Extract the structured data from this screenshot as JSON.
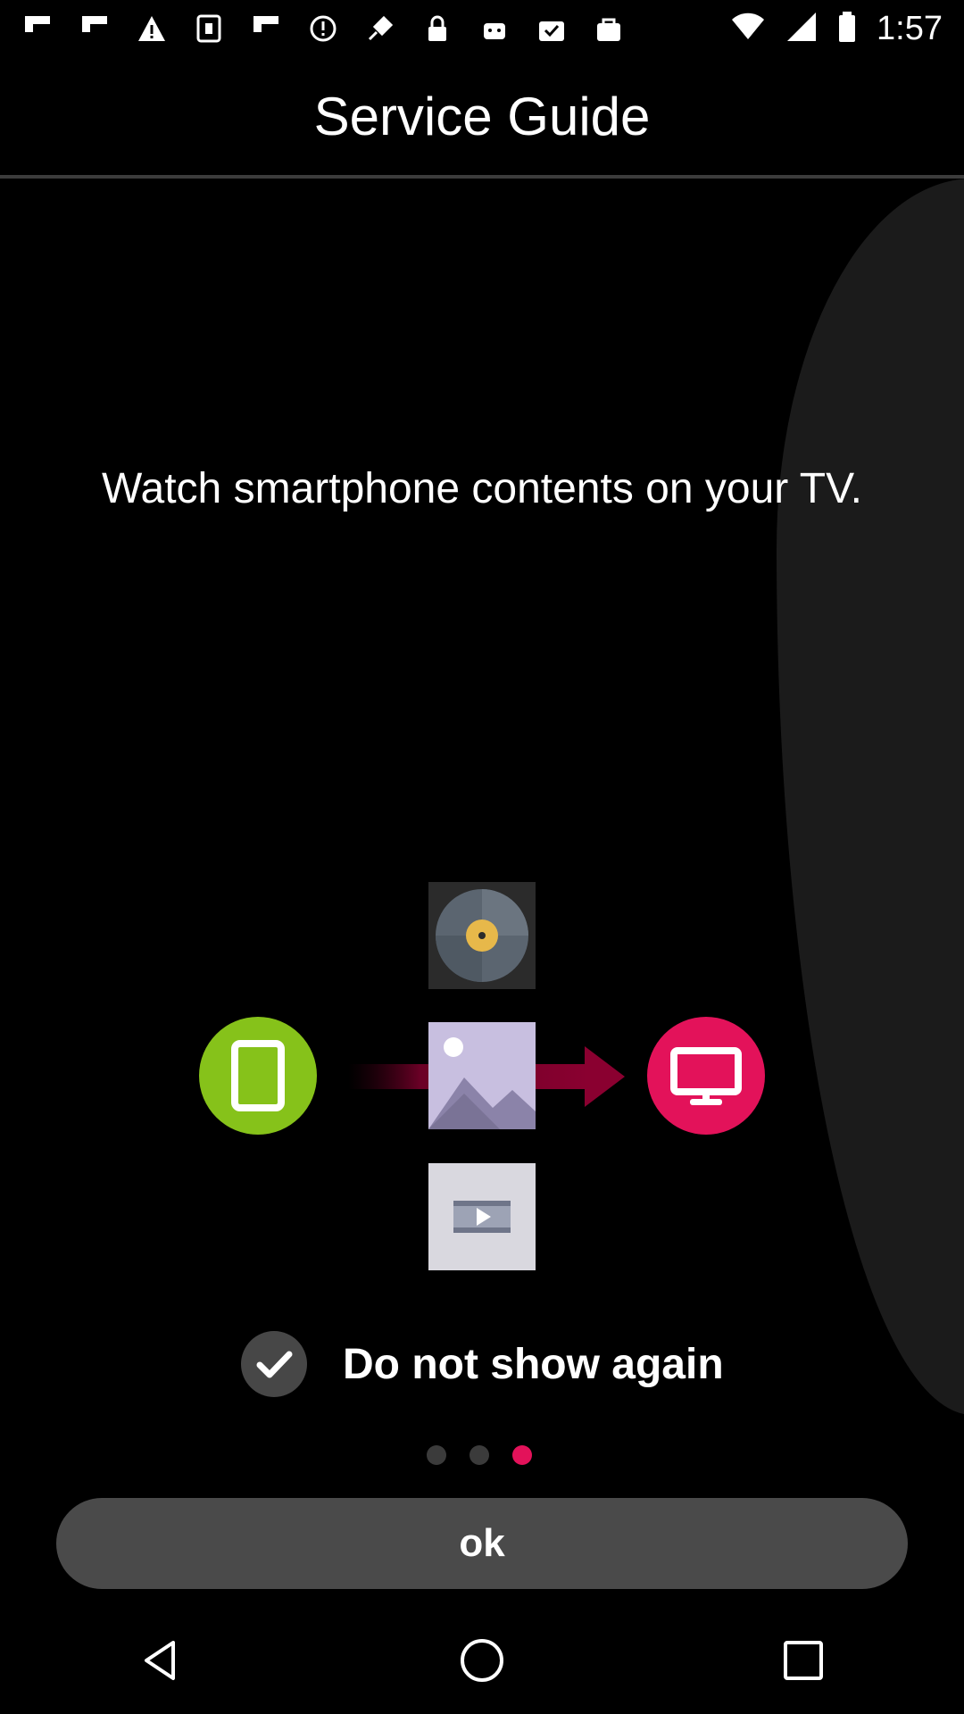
{
  "status_bar": {
    "time": "1:57",
    "left_icons": [
      {
        "name": "flipboard-icon"
      },
      {
        "name": "flipboard-icon-2"
      },
      {
        "name": "warning-icon"
      },
      {
        "name": "app-icon"
      },
      {
        "name": "flipboard-icon-3"
      },
      {
        "name": "alert-icon"
      },
      {
        "name": "fake-gps-icon"
      },
      {
        "name": "lock-icon"
      },
      {
        "name": "android-icon"
      },
      {
        "name": "checkbox-icon"
      },
      {
        "name": "bag-icon"
      }
    ]
  },
  "header": {
    "title": "Service Guide"
  },
  "main": {
    "message": "Watch smartphone contents on your TV.",
    "checkbox_label": "Do not show again",
    "checkbox_checked": true,
    "pager": {
      "total": 3,
      "active_index": 3
    },
    "ok_label": "ok"
  },
  "colors": {
    "accent": "#e3125a",
    "phone": "#86c21a",
    "button": "#4a4a4a"
  }
}
